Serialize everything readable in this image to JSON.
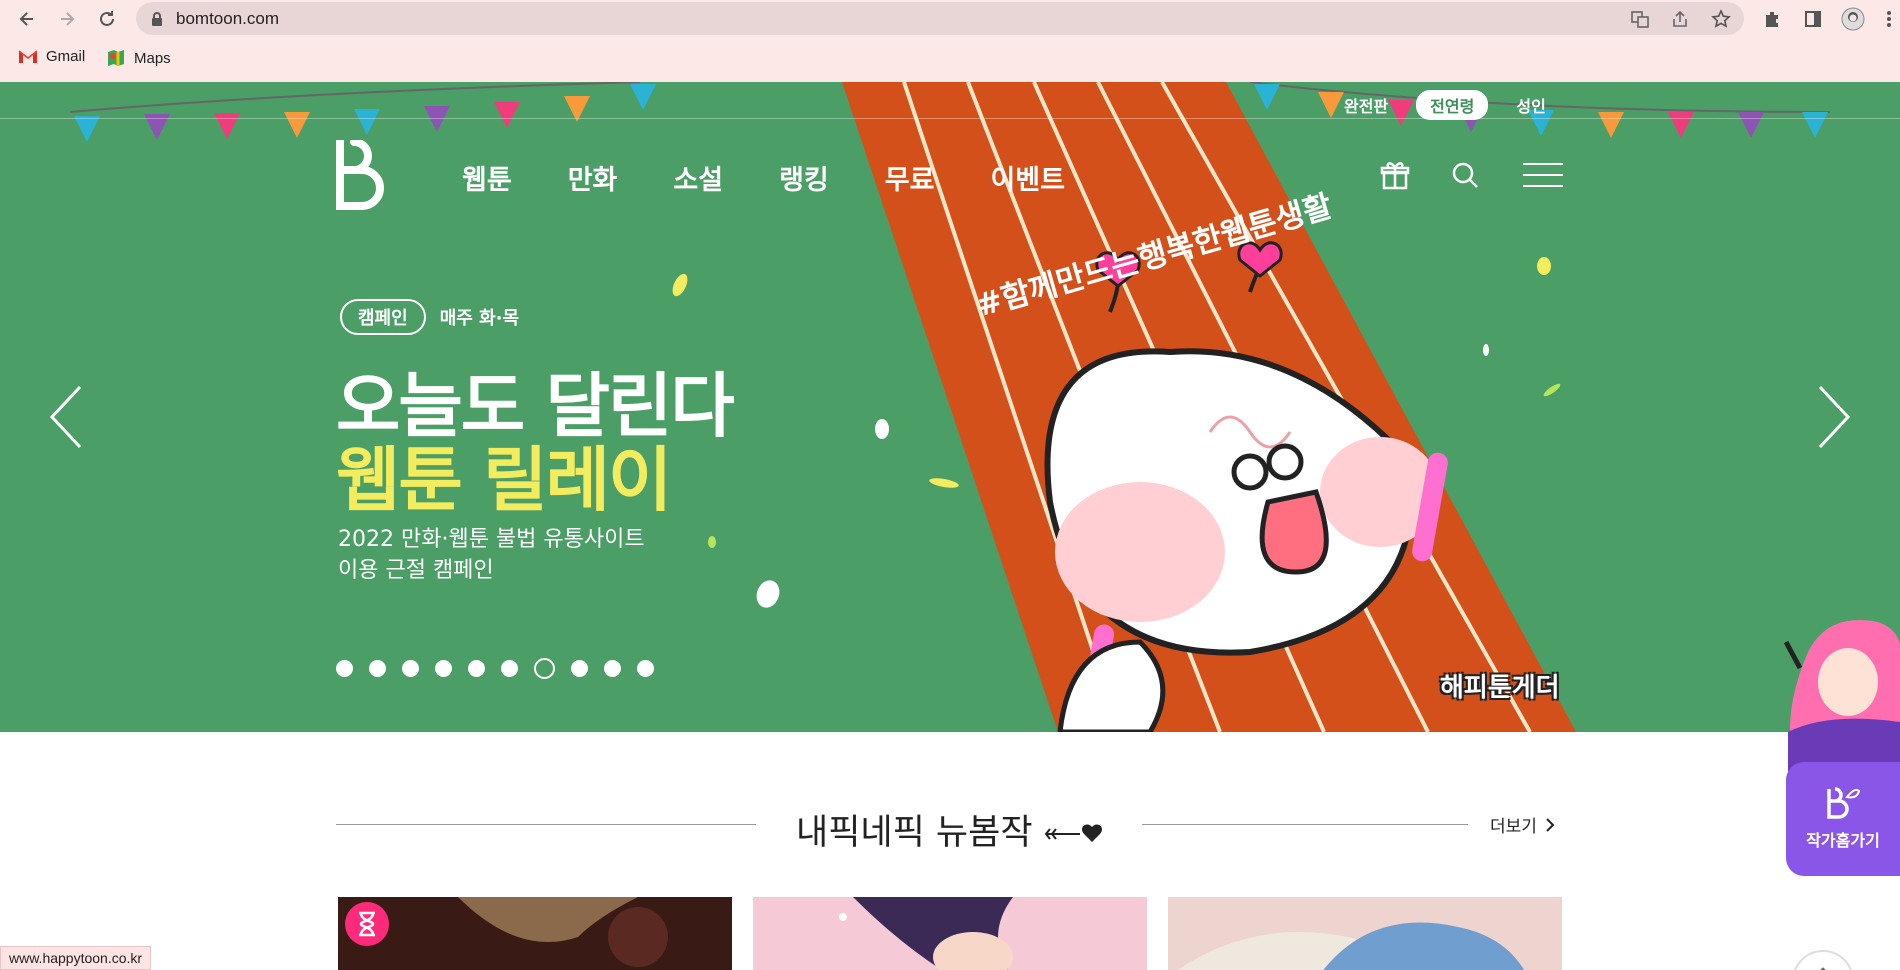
{
  "browser": {
    "url": "bomtoon.com",
    "bookmarks": [
      {
        "label": "Gmail",
        "icon": "gmail-icon"
      },
      {
        "label": "Maps",
        "icon": "maps-icon"
      }
    ],
    "status_url": "www.happytoon.co.kr"
  },
  "site": {
    "ratings": [
      "완전판",
      "전연령",
      "성인"
    ],
    "active_rating": "전연령",
    "nav": [
      "웹툰",
      "만화",
      "소설",
      "랭킹",
      "무료",
      "이벤트"
    ]
  },
  "banner": {
    "badge": "캠페인",
    "schedule": "매주 화·목",
    "headline_1": "오늘도 달린다",
    "headline_2": "웹툰 릴레이",
    "sub_1": "2022 만화·웹툰 불법 유통사이트",
    "sub_2": "이용 근절 캠페인",
    "hashtag": "#함께만드는행복한웹툰생활",
    "logo_text": "해피툰게더",
    "slide_count": 10,
    "active_slide": 7,
    "accent_color": "#f2ec5e",
    "bg_color": "#4a9e66"
  },
  "section": {
    "title": "내픽네픽 뉴봄작",
    "more_label": "더보기"
  },
  "author_home": {
    "label": "작가홈가기"
  }
}
